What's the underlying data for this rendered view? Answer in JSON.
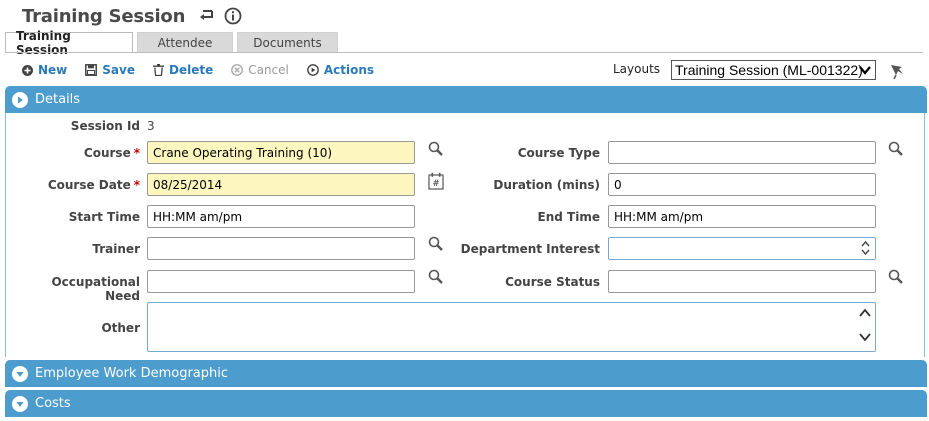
{
  "header": {
    "title": "Training Session"
  },
  "tabs": [
    {
      "label": "Training Session",
      "active": true
    },
    {
      "label": "Attendee",
      "active": false
    },
    {
      "label": "Documents",
      "active": false
    }
  ],
  "toolbar": {
    "new_label": "New",
    "save_label": "Save",
    "delete_label": "Delete",
    "cancel_label": "Cancel",
    "actions_label": "Actions"
  },
  "layouts": {
    "label": "Layouts",
    "selected": "Training Session (ML-001322)"
  },
  "sections": {
    "details": "Details",
    "demographic": "Employee Work Demographic",
    "costs": "Costs"
  },
  "form": {
    "session_id": {
      "label": "Session Id",
      "value": "3"
    },
    "course": {
      "label": "Course",
      "value": "Crane Operating Training (10)",
      "required": true
    },
    "course_type": {
      "label": "Course Type",
      "value": ""
    },
    "course_date": {
      "label": "Course Date",
      "value": "08/25/2014",
      "required": true
    },
    "duration": {
      "label": "Duration (mins)",
      "value": "0"
    },
    "start_time": {
      "label": "Start Time",
      "value": "HH:MM am/pm"
    },
    "end_time": {
      "label": "End Time",
      "value": "HH:MM am/pm"
    },
    "trainer": {
      "label": "Trainer",
      "value": ""
    },
    "department_interest": {
      "label": "Department Interest",
      "value": ""
    },
    "occupational_need": {
      "label": "Occupational Need",
      "value": ""
    },
    "course_status": {
      "label": "Course Status",
      "value": ""
    },
    "other": {
      "label": "Other",
      "value": ""
    }
  },
  "colors": {
    "accent": "#4c9ccd",
    "link": "#2a7ab8",
    "required_bg": "#fdf6bf",
    "required_mark": "#cc0000"
  }
}
